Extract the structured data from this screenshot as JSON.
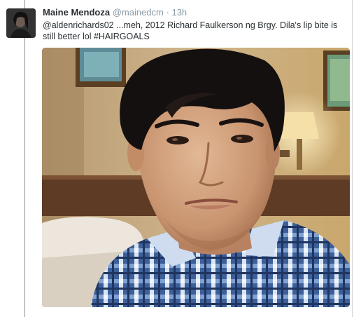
{
  "tweet": {
    "display_name": "Maine Mendoza",
    "handle": "@mainedcm",
    "separator": "·",
    "timestamp": "13h",
    "text": "@aldenrichards02 ...meh, 2012 Richard Faulkerson ng Brgy. Dila's lip bite is still better lol #HAIRGOALS",
    "avatar_icon": "profile-avatar",
    "media_icon": "photo-selfie-man-hotel-room"
  },
  "colors": {
    "name": "#292f33",
    "meta": "#8899a6",
    "text": "#292f33"
  }
}
